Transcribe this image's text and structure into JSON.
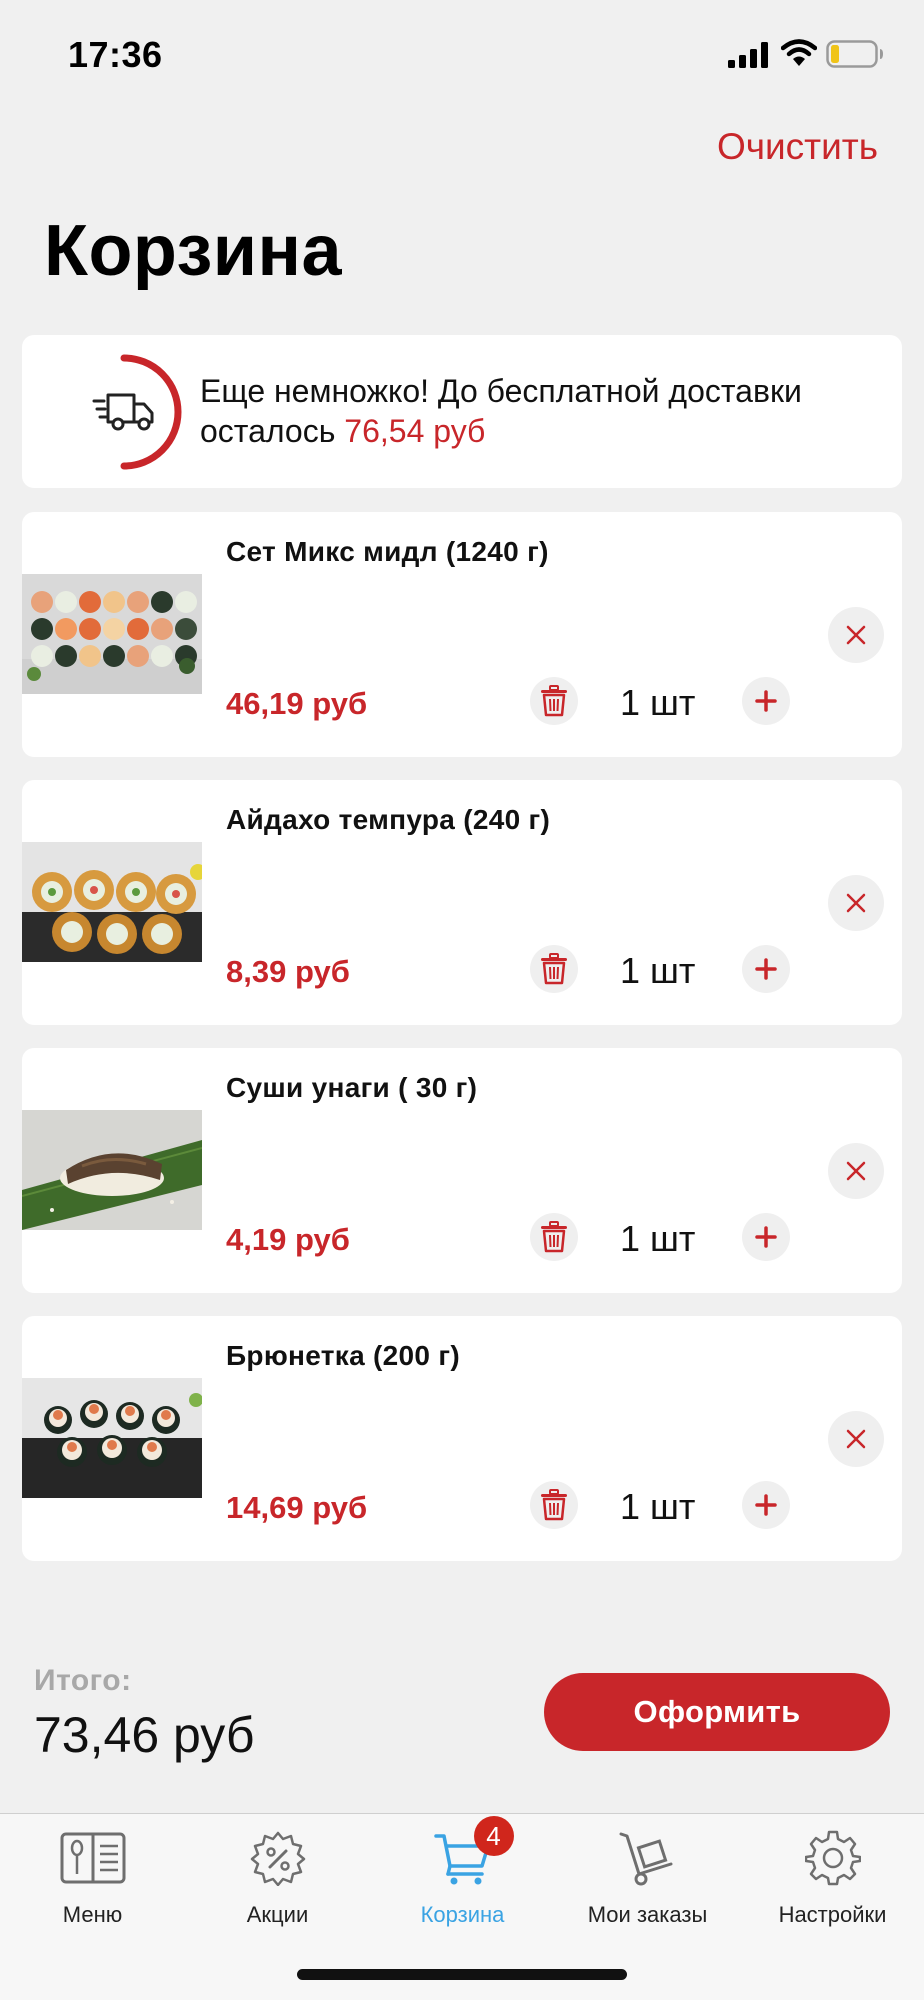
{
  "status_bar": {
    "time": "17:36"
  },
  "header": {
    "clear_label": "Очистить",
    "title": "Корзина"
  },
  "delivery": {
    "message": "Еще немножко! До бесплатной доставки осталось",
    "remaining": "76,54 руб",
    "progress": 0.5
  },
  "items": [
    {
      "name": "Сет Микс мидл (1240 г)",
      "price": "46,19 руб",
      "qty": "1 шт",
      "image": "sushi-set-mix"
    },
    {
      "name": "Айдахо темпура (240 г)",
      "price": "8,39 руб",
      "qty": "1 шт",
      "image": "tempura-rolls"
    },
    {
      "name": "Суши унаги ( 30 г)",
      "price": "4,19 руб",
      "qty": "1 шт",
      "image": "unagi-nigiri"
    },
    {
      "name": "Брюнетка (200 г)",
      "price": "14,69 руб",
      "qty": "1 шт",
      "image": "brunette-rolls"
    }
  ],
  "summary": {
    "total_label": "Итого:",
    "total_value": "73,46 руб",
    "checkout_label": "Оформить"
  },
  "tabs": [
    {
      "label": "Меню",
      "icon": "menu-book-icon"
    },
    {
      "label": "Акции",
      "icon": "discount-gear-icon"
    },
    {
      "label": "Корзина",
      "icon": "cart-icon",
      "badge": "4",
      "active": true
    },
    {
      "label": "Мои заказы",
      "icon": "hand-truck-icon"
    },
    {
      "label": "Настройки",
      "icon": "settings-gear-icon"
    }
  ],
  "colors": {
    "accent": "#c8262a",
    "active_tab": "#3aa3e3",
    "background": "#f0f0f0"
  }
}
